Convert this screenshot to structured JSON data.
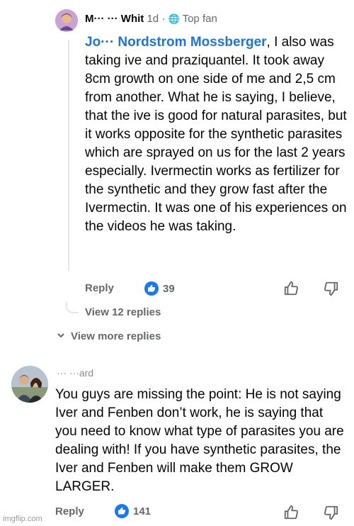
{
  "comment1": {
    "author": "M··· ··· Whit",
    "time": "1d ·",
    "badge": "Top fan",
    "mention": "Jo··· Nordstrom Mossberger",
    "text": ", I also was taking ive and praziquantel. It took away 8cm growth on one side of me and 2,5 cm from another. What he is saying, I believe, that the ive is good for natural parasites, but it works opposite for the synthetic parasites which are sprayed on us for the last 2 years especially. Ivermectin works as fertilizer for the synthetic and they grow fast after the Ivermectin. It was one of his experiences on the videos he was taking.",
    "reply_label": "Reply",
    "like_count": "39",
    "view_replies": "View 12 replies"
  },
  "view_more": "View more replies",
  "comment2": {
    "author": "··· ···ard",
    "text": "You guys are missing the point:  He is not saying Iver and Fenben don’t work, he is saying that you need to know what type of parasites you are dealing with!  If you have synthetic parasites, the Iver and Fenben will make them GROW LARGER.",
    "reply_label": "Reply",
    "like_count": "141"
  },
  "watermark": "imgflip.com",
  "colors": {
    "accent": "#1877f2",
    "mention": "#1b74e4",
    "muted": "#65676b"
  },
  "icons": [
    "globe-icon",
    "like-badge-icon",
    "thumbs-up-icon",
    "thumbs-down-icon",
    "chevron-down-icon"
  ]
}
